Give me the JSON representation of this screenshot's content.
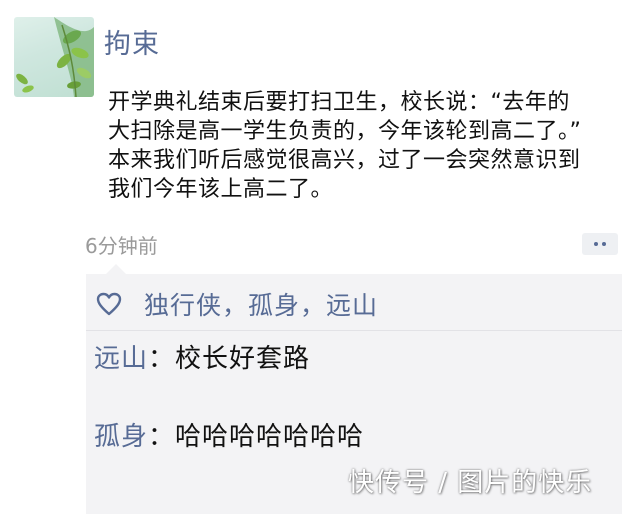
{
  "post": {
    "author": "拘束",
    "text": "开学典礼结束后要打扫卫生，校长说：“去年的\n大扫除是高一学生负责的，今年该轮到高二了。”\n本来我们听后感觉很高兴，过了一会突然意识到\n我们今年该上高二了。",
    "time": "6分钟前",
    "avatar_icon": "leaves-avatar-icon"
  },
  "likes": {
    "icon": "heart-icon",
    "names": "独行侠，孤身，远山"
  },
  "comments": [
    {
      "name": "远山",
      "separator": "：",
      "text": "校长好套路"
    },
    {
      "name": "孤身",
      "separator": "：",
      "text": "哈哈哈哈哈哈哈"
    }
  ],
  "watermark": "快传号 / 图片的快乐",
  "colors": {
    "link": "#576b95",
    "comment_bg": "#f3f3f5"
  }
}
